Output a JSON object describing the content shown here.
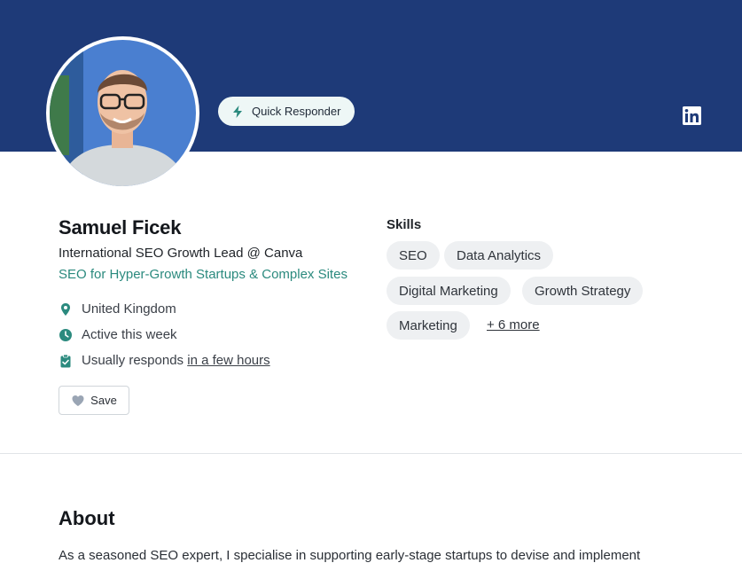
{
  "header": {
    "badge_label": "Quick Responder",
    "social_icon": "linkedin-icon",
    "banner_color": "#1e3a78"
  },
  "profile": {
    "name": "Samuel Ficek",
    "headline": "International SEO Growth Lead @ Canva",
    "tagline": "SEO for Hyper-Growth Startups & Complex Sites",
    "location": "United Kingdom",
    "activity": "Active this week",
    "response_prefix": "Usually responds",
    "response_time": "in a few hours",
    "save_label": "Save",
    "accent_color": "#2b8a7e"
  },
  "skills": {
    "title": "Skills",
    "items": [
      "SEO",
      "Data Analytics",
      "Digital Marketing",
      "Growth Strategy",
      "Marketing"
    ],
    "more_label": "+ 6 more"
  },
  "about": {
    "title": "About",
    "text": "As a seasoned SEO expert, I specialise in supporting early-stage startups to devise and implement"
  }
}
